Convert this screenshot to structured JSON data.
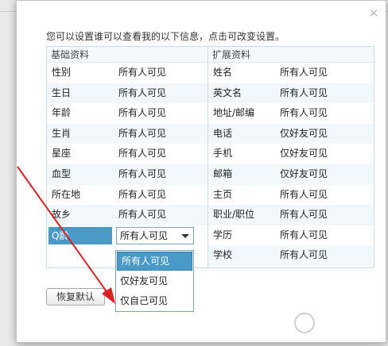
{
  "description": "您可以设置谁可以查看我的以下信息，点击可改变设置。",
  "basic": {
    "title": "基础资料",
    "rows": [
      {
        "label": "性别",
        "value": "所有人可见"
      },
      {
        "label": "生日",
        "value": "所有人可见"
      },
      {
        "label": "年龄",
        "value": "所有人可见"
      },
      {
        "label": "生肖",
        "value": "所有人可见"
      },
      {
        "label": "星座",
        "value": "所有人可见"
      },
      {
        "label": "血型",
        "value": "所有人可见"
      },
      {
        "label": "所在地",
        "value": "所有人可见"
      },
      {
        "label": "故乡",
        "value": "所有人可见"
      }
    ],
    "selected_row": {
      "label": "Q龄",
      "value": "所有人可见"
    }
  },
  "extended": {
    "title": "扩展资料",
    "rows": [
      {
        "label": "姓名",
        "value": "所有人可见"
      },
      {
        "label": "英文名",
        "value": "所有人可见"
      },
      {
        "label": "地址/邮编",
        "value": "所有人可见"
      },
      {
        "label": "电话",
        "value": "仅好友可见"
      },
      {
        "label": "手机",
        "value": "仅好友可见"
      },
      {
        "label": "邮箱",
        "value": "仅好友可见"
      },
      {
        "label": "主页",
        "value": "所有人可见"
      },
      {
        "label": "职业/职位",
        "value": "所有人可见"
      },
      {
        "label": "学历",
        "value": "所有人可见"
      },
      {
        "label": "学校",
        "value": "所有人可见"
      }
    ]
  },
  "dropdown": {
    "options": [
      "所有人可见",
      "仅好友可见",
      "仅自己可见"
    ],
    "active_index": 0
  },
  "reset_label": "恢复默认",
  "close_glyph": "×",
  "colors": {
    "accent": "#4a9ac7",
    "annotation_arrow": "#e02020",
    "row_alt": "#f1f7fb"
  }
}
